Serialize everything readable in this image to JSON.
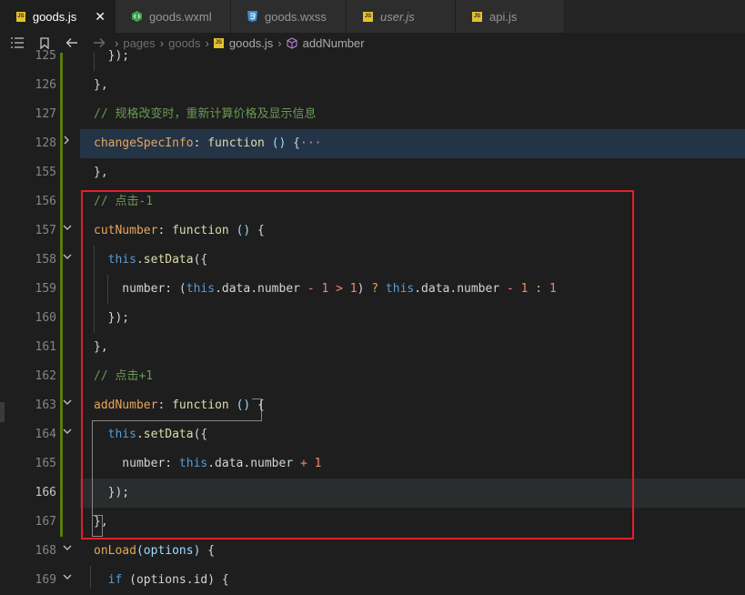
{
  "tabs": [
    {
      "label": "goods.js",
      "icon": "js-file-icon",
      "active": true,
      "italic": false
    },
    {
      "label": "goods.wxml",
      "icon": "wxml-file-icon",
      "active": false,
      "italic": false
    },
    {
      "label": "goods.wxss",
      "icon": "css-file-icon",
      "active": false,
      "italic": false
    },
    {
      "label": "user.js",
      "icon": "js-file-icon",
      "active": false,
      "italic": true
    },
    {
      "label": "api.js",
      "icon": "js-file-icon",
      "active": false,
      "italic": false
    }
  ],
  "breadcrumb": {
    "items": [
      "pages",
      "goods",
      "goods.js",
      "addNumber"
    ]
  },
  "colors": {
    "highlight_border": "#e51e2b",
    "modified_bar": "#587c0c"
  },
  "editor": {
    "current_line": "166",
    "lines": [
      {
        "no": "125",
        "text": "  });"
      },
      {
        "no": "126",
        "text": "},"
      },
      {
        "no": "127",
        "text": "// 规格改变时，重新计算价格及显示信息"
      },
      {
        "no": "128",
        "text": "changeSpecInfo: function () {···"
      },
      {
        "no": "155",
        "text": "},"
      },
      {
        "no": "156",
        "text": "// 点击-1"
      },
      {
        "no": "157",
        "text": "cutNumber: function () {"
      },
      {
        "no": "158",
        "text": "  this.setData({"
      },
      {
        "no": "159",
        "text": "    number: (this.data.number - 1 > 1) ? this.data.number - 1 : 1"
      },
      {
        "no": "160",
        "text": "  });"
      },
      {
        "no": "161",
        "text": "},"
      },
      {
        "no": "162",
        "text": "// 点击+1"
      },
      {
        "no": "163",
        "text": "addNumber: function () {"
      },
      {
        "no": "164",
        "text": "  this.setData({"
      },
      {
        "no": "165",
        "text": "    number: this.data.number + 1"
      },
      {
        "no": "166",
        "text": "  });"
      },
      {
        "no": "167",
        "text": "},"
      },
      {
        "no": "168",
        "text": "onLoad(options) {"
      },
      {
        "no": "169",
        "text": "  if (options.id) {"
      }
    ]
  }
}
